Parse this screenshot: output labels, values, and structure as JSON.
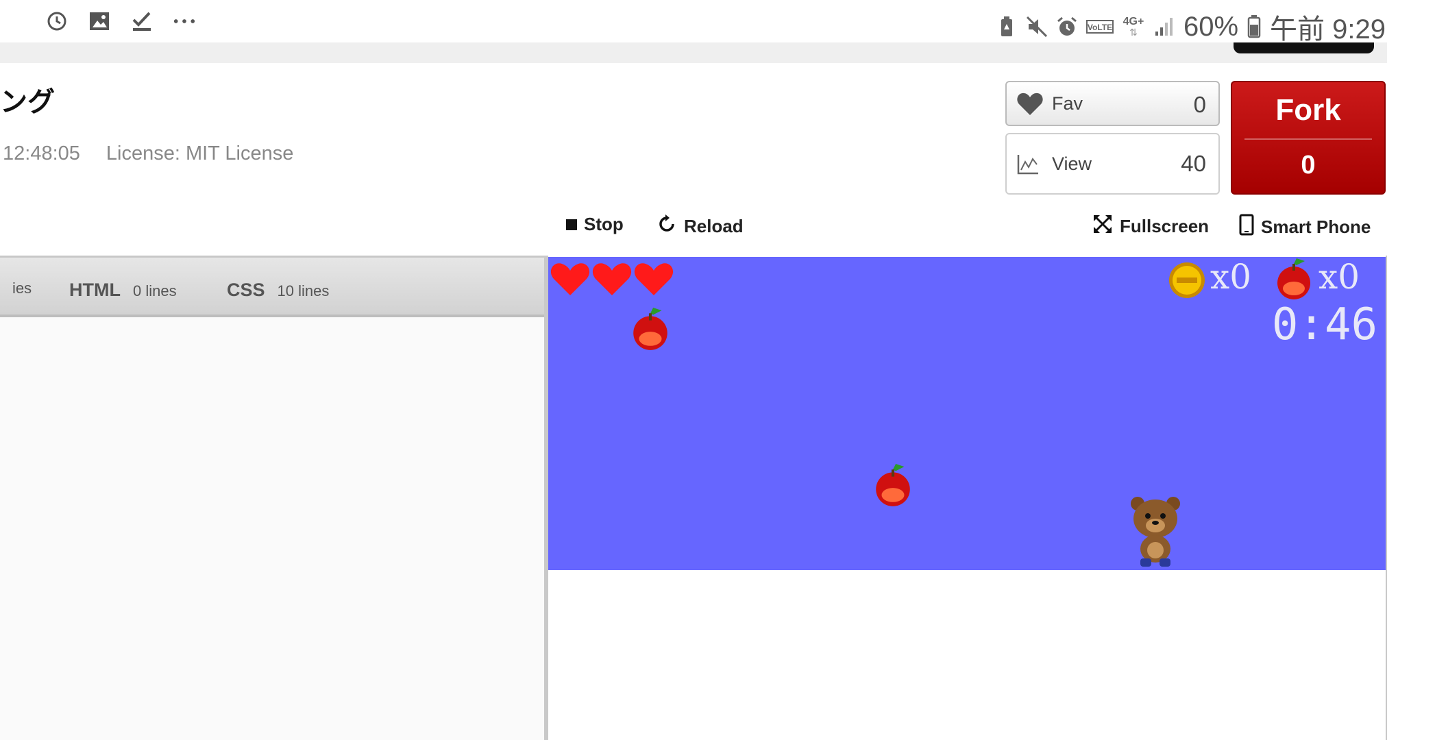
{
  "status_bar": {
    "left_icons": [
      "clock-icon",
      "image-icon",
      "check-icon",
      "more-icon"
    ],
    "right_icons": [
      "battery-saver-icon",
      "mute-icon",
      "alarm-icon",
      "volte-icon",
      "4g-icon",
      "signal-icon",
      "battery-icon"
    ],
    "network_label": "4G+",
    "volte_label": "VoLTE",
    "battery_percent": "60%",
    "time": "午前 9:29"
  },
  "page": {
    "title": "ング",
    "timestamp": "12:48:05",
    "license": "License: MIT License"
  },
  "stats": {
    "fav_label": "Fav",
    "fav_count": "0",
    "view_label": "View",
    "view_count": "40"
  },
  "fork": {
    "label": "Fork",
    "count": "0"
  },
  "toolbar": {
    "stop_label": "Stop",
    "reload_label": "Reload",
    "fullscreen_label": "Fullscreen",
    "smartphone_label": "Smart Phone"
  },
  "editor": {
    "tabs": [
      {
        "name": "",
        "lines": "ies"
      },
      {
        "name": "HTML",
        "lines": "0 lines"
      },
      {
        "name": "CSS",
        "lines": "10 lines"
      }
    ]
  },
  "game": {
    "background": "#6666ff",
    "lives": 3,
    "coin_count": "x0",
    "apple_count": "x0",
    "timer": "0:46"
  },
  "colors": {
    "fork_red": "#b30000",
    "game_bg": "#6666ff",
    "heart_red": "#ff1a1a"
  }
}
